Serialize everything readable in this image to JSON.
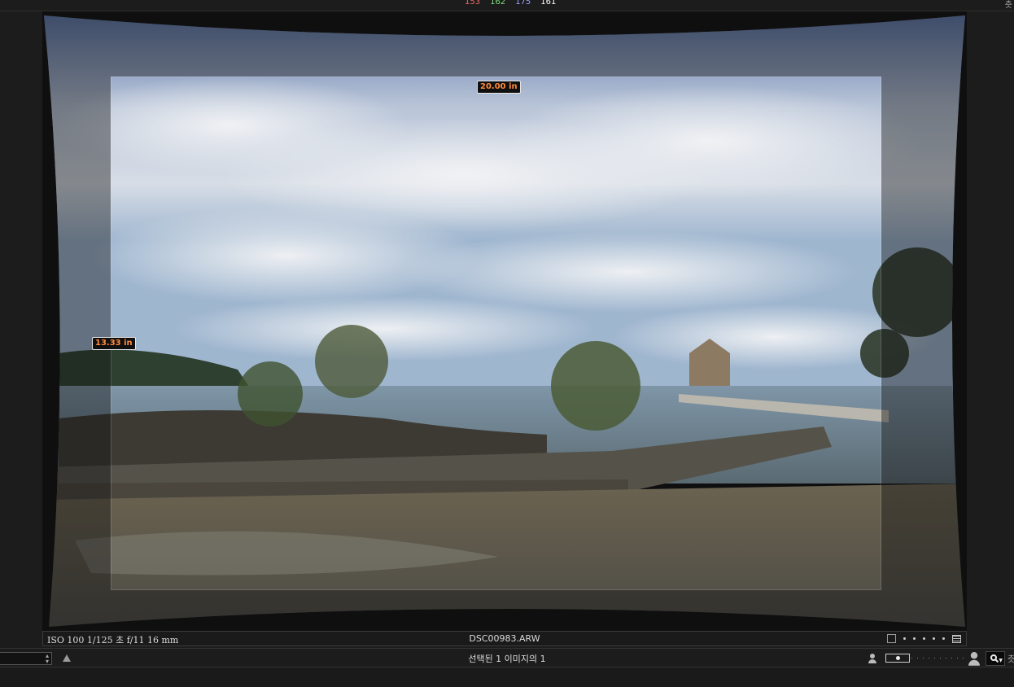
{
  "histogram_readout": {
    "r": "153",
    "g": "162",
    "b": "175",
    "k": "161"
  },
  "top_right_text": "츳",
  "crop": {
    "width_label": "20.00 in",
    "height_label": "13.33 in"
  },
  "status": {
    "exif": "ISO 100 1/125 초 f/11 16 mm",
    "filename": "DSC00983.ARW"
  },
  "bottom": {
    "selection_text": "선택된 1 이미지의 1",
    "right_text": "츳"
  },
  "colors": {
    "accent_label": "#ff8a3d",
    "background": "#1c1c1c"
  }
}
